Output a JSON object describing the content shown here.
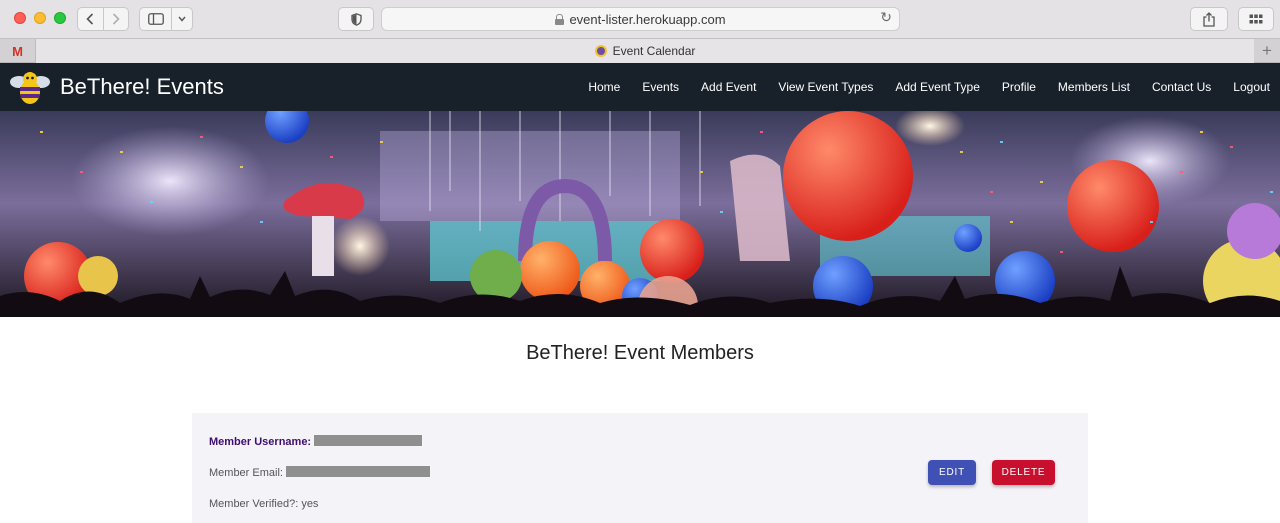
{
  "browser": {
    "url": "event-lister.herokuapp.com",
    "tab_title": "Event Calendar",
    "pinned_tab_glyph": "M",
    "new_tab_glyph": "+"
  },
  "site": {
    "brand": "BeThere! Events",
    "nav": [
      "Home",
      "Events",
      "Add Event",
      "View Event Types",
      "Add Event Type",
      "Profile",
      "Members List",
      "Contact Us",
      "Logout"
    ]
  },
  "page": {
    "heading": "BeThere! Event Members"
  },
  "member": {
    "username_label": "Member Username:",
    "email_label": "Member Email:",
    "verified_label": "Member Verified?: yes",
    "edit_button": "EDIT",
    "delete_button": "DELETE"
  },
  "colors": {
    "navbar": "#18202a",
    "card": "#f4f3f8",
    "edit": "#3f51b5",
    "delete": "#c8102e",
    "username": "#3f0e6e"
  },
  "icons": [
    "back-icon",
    "forward-icon",
    "sidebar-icon",
    "chevron-down-icon",
    "shield-icon",
    "lock-icon",
    "reload-icon",
    "share-icon",
    "tab-overview-icon",
    "gmail-icon",
    "bee-logo"
  ]
}
